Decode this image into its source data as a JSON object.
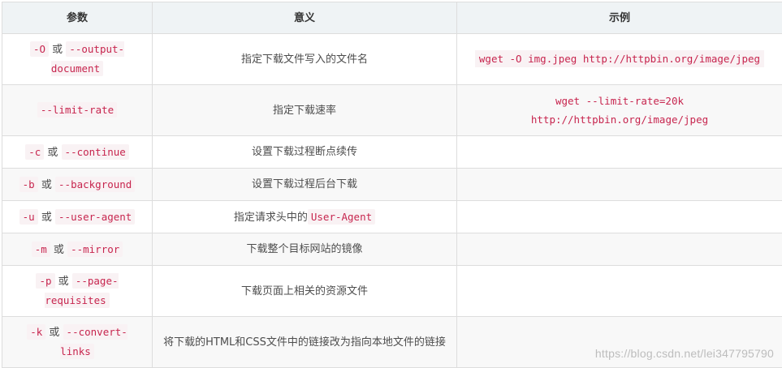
{
  "headers": [
    "参数",
    "意义",
    "示例"
  ],
  "rows": [
    {
      "param_parts": [
        "-O",
        "或",
        "--output-document"
      ],
      "meaning": "指定下载文件写入的文件名",
      "example": "wget -O img.jpeg http://httpbin.org/image/jpeg"
    },
    {
      "param_parts": [
        "--limit-rate"
      ],
      "meaning": "指定下载速率",
      "example": "wget --limit-rate=20k http://httpbin.org/image/jpeg"
    },
    {
      "param_parts": [
        "-c",
        "或",
        "--continue"
      ],
      "meaning": "设置下载过程断点续传",
      "example": ""
    },
    {
      "param_parts": [
        "-b",
        "或",
        "--background"
      ],
      "meaning": "设置下载过程后台下载",
      "example": ""
    },
    {
      "param_parts": [
        "-u",
        "或",
        "--user-agent"
      ],
      "meaning_parts": [
        "指定请求头中的",
        "User-Agent"
      ],
      "example": ""
    },
    {
      "param_parts": [
        "-m",
        "或",
        "--mirror"
      ],
      "meaning": "下载整个目标网站的镜像",
      "example": ""
    },
    {
      "param_parts": [
        "-p",
        "或",
        "--page-requisites"
      ],
      "meaning": "下载页面上相关的资源文件",
      "example": ""
    },
    {
      "param_parts": [
        "-k",
        "或",
        "--convert-links"
      ],
      "meaning": "将下载的HTML和CSS文件中的链接改为指向本地文件的链接",
      "example": ""
    }
  ],
  "watermark": "https://blog.csdn.net/lei347795790"
}
